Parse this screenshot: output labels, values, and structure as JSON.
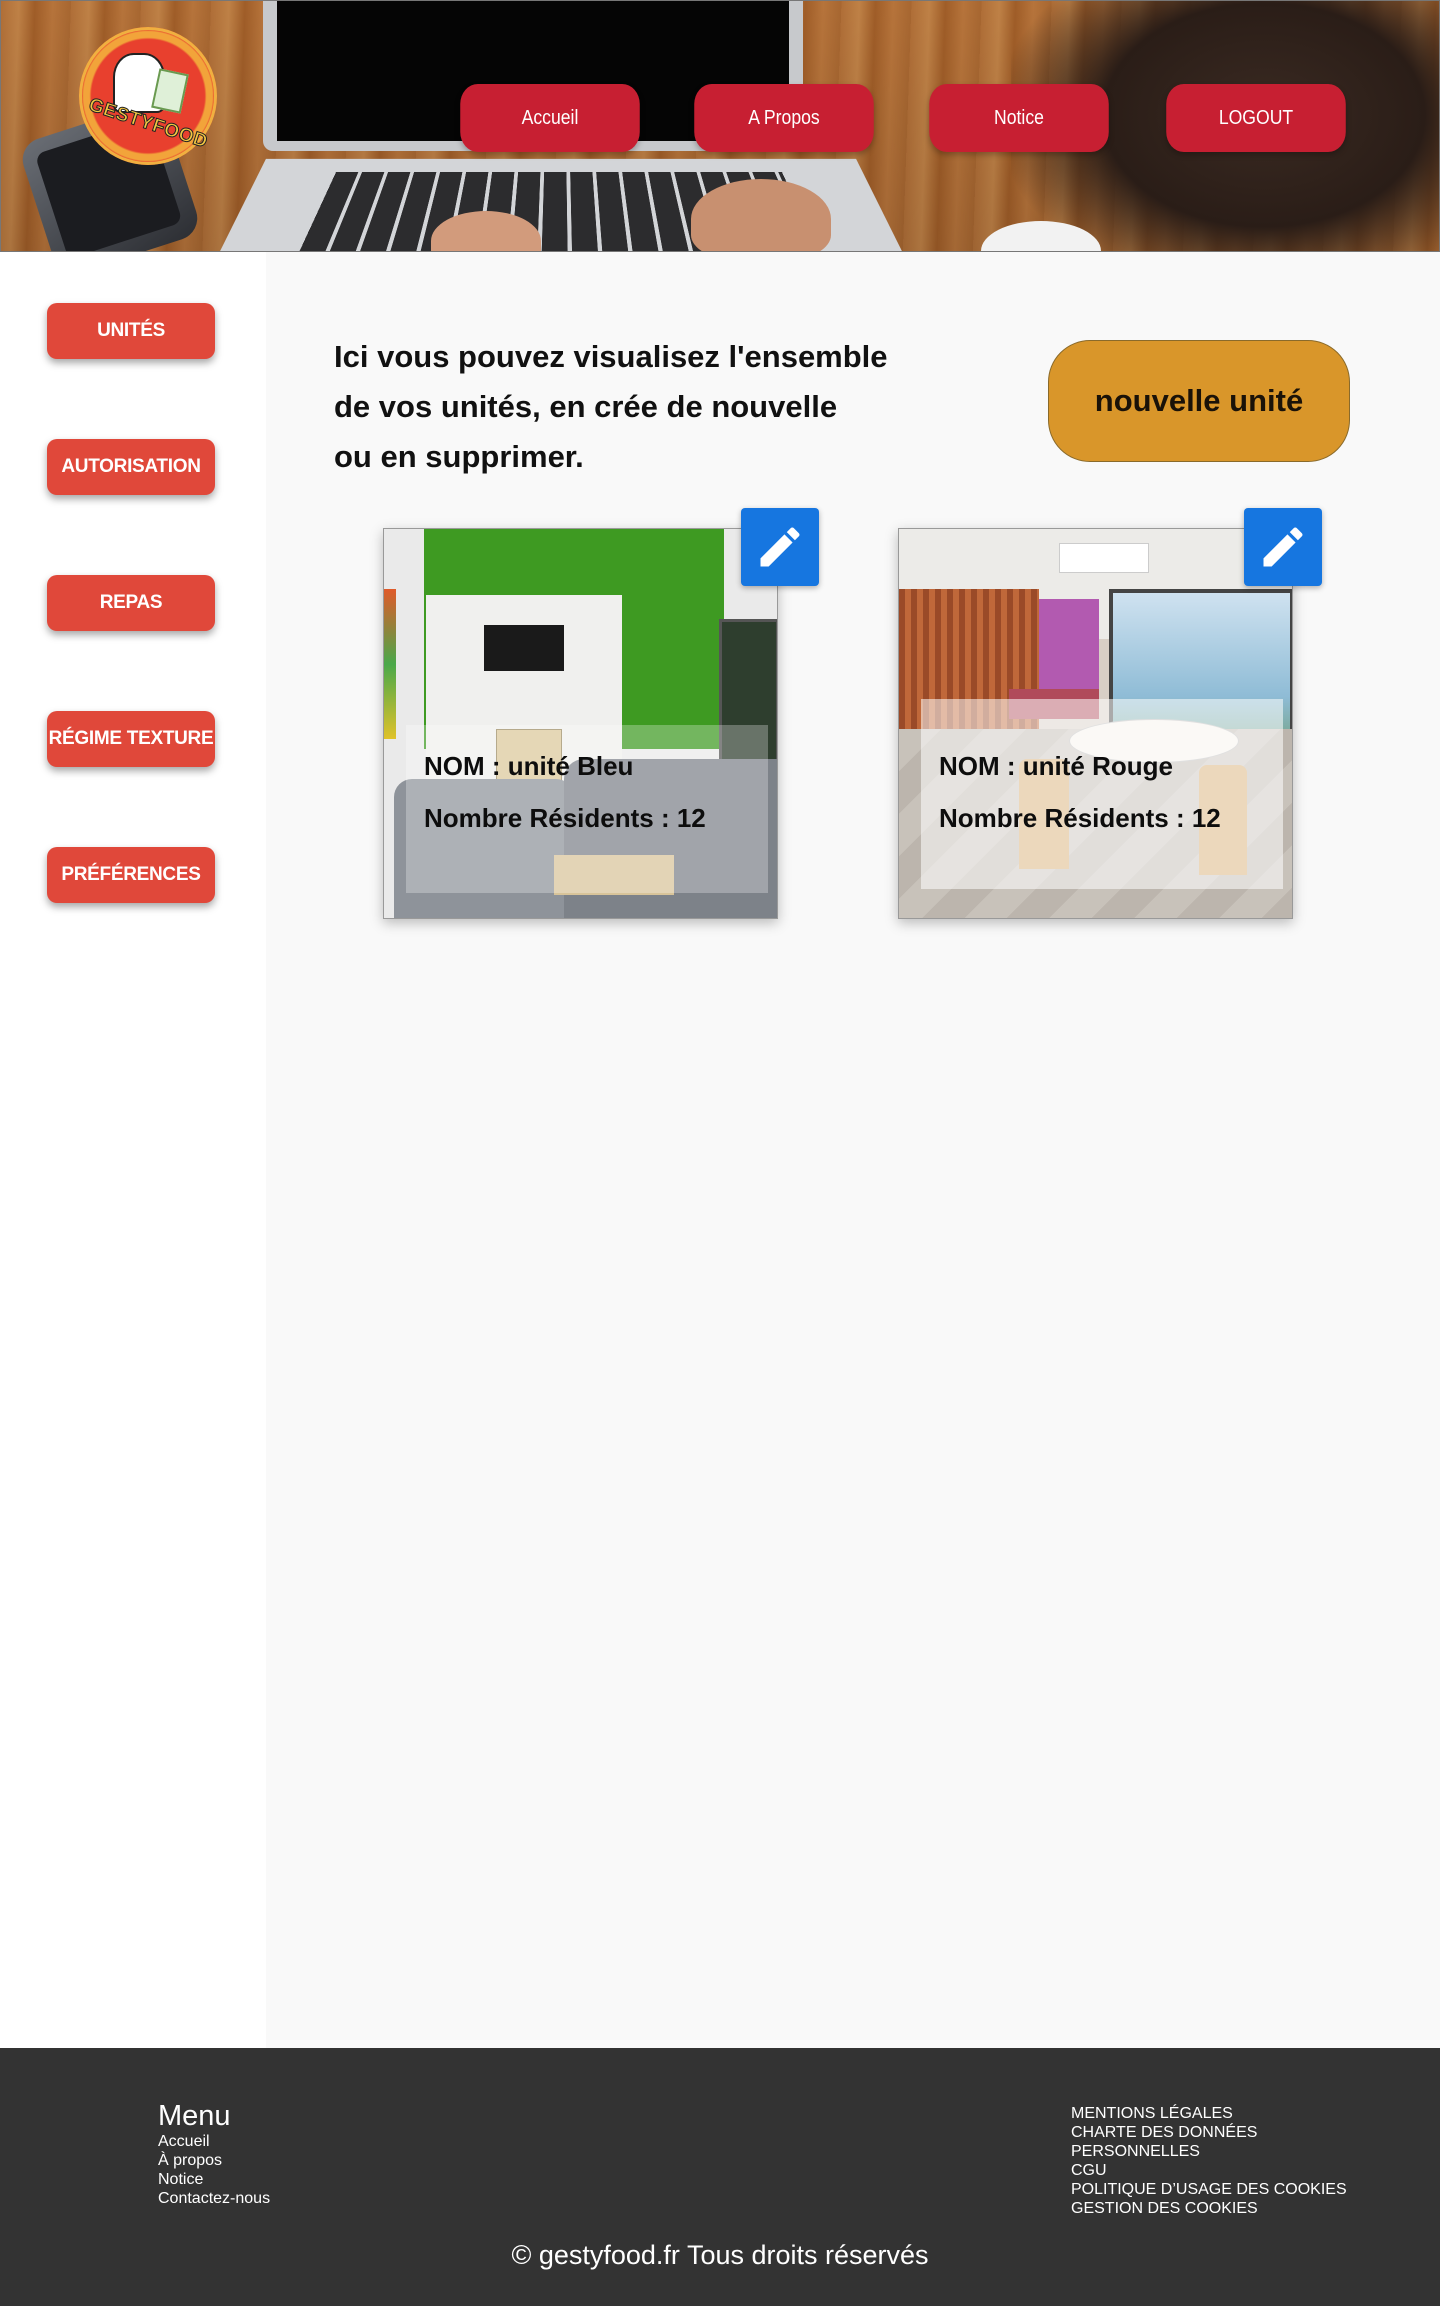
{
  "header": {
    "logo_text": "GESTYFOOD",
    "nav": [
      {
        "label": "Accueil"
      },
      {
        "label": "A Propos"
      },
      {
        "label": "Notice"
      },
      {
        "label": "LOGOUT"
      }
    ]
  },
  "sidebar": {
    "items": [
      {
        "label": "UNITÉS"
      },
      {
        "label": "AUTORISATION"
      },
      {
        "label": "REPAS"
      },
      {
        "label": "RÉGIME TEXTURE"
      },
      {
        "label": "PRÉFÉRENCES"
      }
    ]
  },
  "main": {
    "intro_lines": [
      "Ici vous pouvez visualisez l'ensemble",
      "de vos unités,  en crée de nouvelle",
      "ou en supprimer."
    ],
    "new_unit_label": "nouvelle  unité",
    "units": [
      {
        "name_line": "NOM : unité Bleu",
        "residents_line": "Nombre Résidents : 12",
        "edit_icon": "pencil-icon"
      },
      {
        "name_line": "NOM : unité Rouge",
        "residents_line": "Nombre Résidents : 12",
        "edit_icon": "pencil-icon"
      }
    ]
  },
  "footer": {
    "menu_title": "Menu",
    "menu_links": [
      "Accueil",
      "À propos",
      "Notice",
      "Contactez-nous"
    ],
    "legal_links": [
      "MENTIONS LÉGALES",
      "CHARTE DES DONNÉES",
      "PERSONNELLES",
      "CGU",
      "POLITIQUE D’USAGE DES COOKIES",
      "GESTION DES COOKIES"
    ],
    "copyright": "© gestyfood.fr  Tous droits réservés"
  },
  "colors": {
    "nav_button": "#c71f32",
    "sidebar_button": "#e0483a",
    "new_unit_button": "#d9962a",
    "edit_button": "#1676e0",
    "footer_bg": "#333333"
  }
}
